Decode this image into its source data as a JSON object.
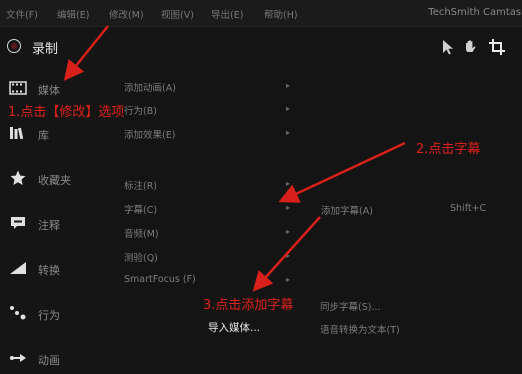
{
  "menubar": {
    "items": [
      "文件(F)",
      "编辑(E)",
      "修改(M)",
      "视图(V)",
      "导出(E)",
      "帮助(H)"
    ],
    "app_title": "TechSmith Camtasia"
  },
  "sidebar": {
    "record_label": "录制",
    "items": [
      {
        "label": "媒体",
        "icon": "film-icon"
      },
      {
        "label": "库",
        "icon": "library-icon"
      },
      {
        "label": "收藏夹",
        "icon": "star-icon"
      },
      {
        "label": "注释",
        "icon": "annotation-icon"
      },
      {
        "label": "转换",
        "icon": "transition-icon"
      },
      {
        "label": "行为",
        "icon": "behavior-icon"
      },
      {
        "label": "动画",
        "icon": "animation-icon"
      }
    ]
  },
  "toolbar": {
    "tools": [
      "pointer-icon",
      "hand-icon",
      "crop-icon"
    ]
  },
  "dropdown": {
    "items": [
      {
        "label": "添加动画(A)",
        "arrow": "▸"
      },
      {
        "label": "行为(B)",
        "arrow": "▸"
      },
      {
        "label": "添加效果(E)",
        "arrow": "▸"
      },
      {
        "label": "标注(R)",
        "arrow": "▸"
      },
      {
        "label": "字幕(C)",
        "arrow": "▸"
      },
      {
        "label": "音频(M)",
        "arrow": "▸"
      },
      {
        "label": "测验(Q)",
        "arrow": "▸"
      },
      {
        "label": "SmartFocus (F)",
        "arrow": "▸"
      }
    ]
  },
  "submenu": {
    "add_caption": "添加字幕(A)",
    "add_caption_shortcut": "Shift+C",
    "sync_captions": "同步字幕(S)...",
    "speech_to_text": "语音转换为文本(T)"
  },
  "context": {
    "import_media": "导入媒体..."
  },
  "annotations": {
    "step1": "1.点击【修改】选项",
    "step2": "2.点击字幕",
    "step3": "3.点击添加字幕"
  }
}
